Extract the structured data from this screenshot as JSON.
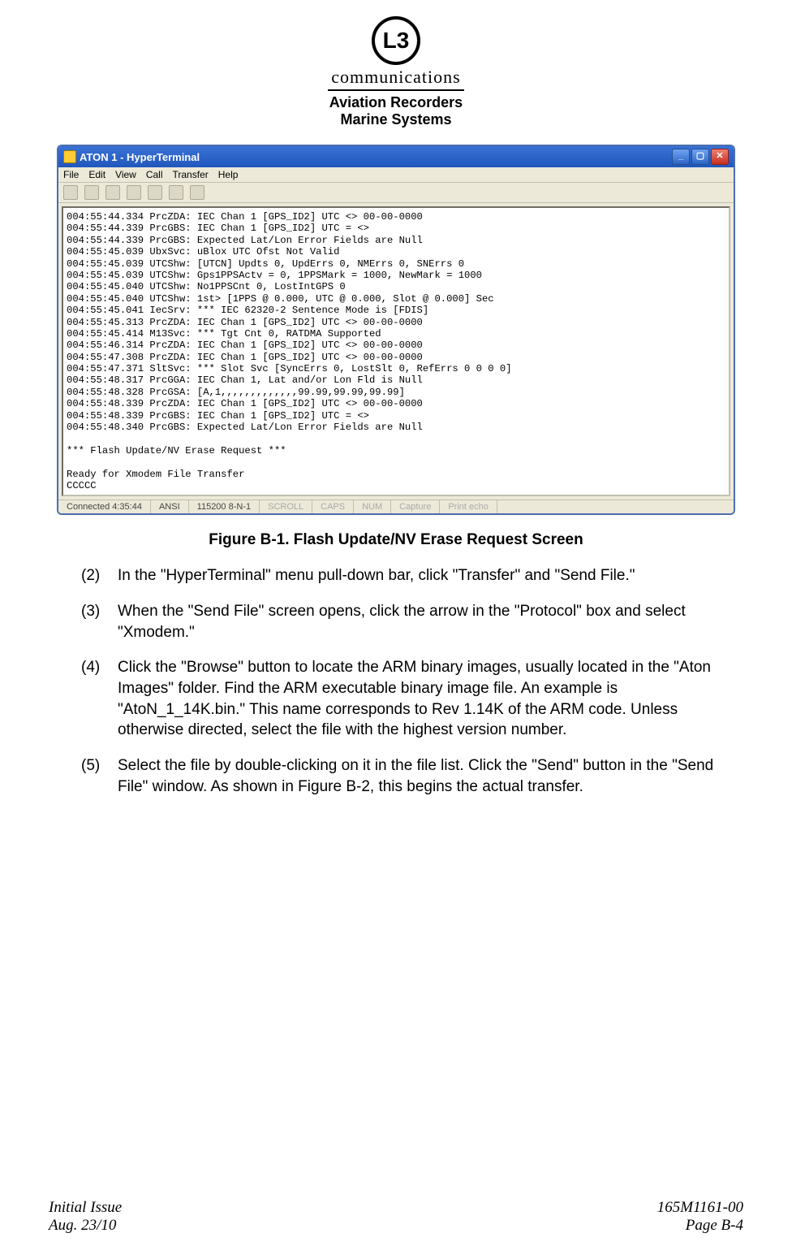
{
  "header": {
    "logo_text": "L3",
    "logo_sub": "communications",
    "line1": "Aviation Recorders",
    "line2": "Marine Systems"
  },
  "window": {
    "title": "ATON 1 - HyperTerminal",
    "menu": [
      "File",
      "Edit",
      "View",
      "Call",
      "Transfer",
      "Help"
    ],
    "terminal_lines": [
      "004:55:44.334 PrcZDA: IEC Chan 1 [GPS_ID2] UTC <> 00-00-0000",
      "004:55:44.339 PrcGBS: IEC Chan 1 [GPS_ID2] UTC = <>",
      "004:55:44.339 PrcGBS: Expected Lat/Lon Error Fields are Null",
      "004:55:45.039 UbxSvc: uBlox UTC Ofst Not Valid",
      "004:55:45.039 UTCShw: [UTCN] Updts 0, UpdErrs 0, NMErrs 0, SNErrs 0",
      "004:55:45.039 UTCShw: Gps1PPSActv = 0, 1PPSMark = 1000, NewMark = 1000",
      "004:55:45.040 UTCShw: No1PPSCnt 0, LostIntGPS 0",
      "004:55:45.040 UTCShw: 1st> [1PPS @ 0.000, UTC @ 0.000, Slot @ 0.000] Sec",
      "004:55:45.041 IecSrv: *** IEC 62320-2 Sentence Mode is [FDIS]",
      "004:55:45.313 PrcZDA: IEC Chan 1 [GPS_ID2] UTC <> 00-00-0000",
      "004:55:45.414 M13Svc: *** Tgt Cnt 0, RATDMA Supported",
      "004:55:46.314 PrcZDA: IEC Chan 1 [GPS_ID2] UTC <> 00-00-0000",
      "004:55:47.308 PrcZDA: IEC Chan 1 [GPS_ID2] UTC <> 00-00-0000",
      "004:55:47.371 SltSvc: *** Slot Svc [SyncErrs 0, LostSlt 0, RefErrs 0 0 0 0]",
      "004:55:48.317 PrcGGA: IEC Chan 1, Lat and/or Lon Fld is Null",
      "004:55:48.328 PrcGSA: [A,1,,,,,,,,,,,,,99.99,99.99,99.99]",
      "004:55:48.339 PrcZDA: IEC Chan 1 [GPS_ID2] UTC <> 00-00-0000",
      "004:55:48.339 PrcGBS: IEC Chan 1 [GPS_ID2] UTC = <>",
      "004:55:48.340 PrcGBS: Expected Lat/Lon Error Fields are Null",
      "",
      "*** Flash Update/NV Erase Request ***",
      "",
      "Ready for Xmodem File Transfer",
      "CCCCC"
    ],
    "status": {
      "connected": "Connected 4:35:44",
      "emulation": "ANSI",
      "port": "115200 8-N-1",
      "scroll": "SCROLL",
      "caps": "CAPS",
      "num": "NUM",
      "capture": "Capture",
      "print": "Print echo"
    }
  },
  "figure_caption": "Figure B-1.  Flash Update/NV Erase Request Screen",
  "steps": [
    {
      "num": "(2)",
      "text": "In the \"HyperTerminal\" menu pull-down bar, click \"Transfer\" and \"Send File.\""
    },
    {
      "num": "(3)",
      "text": "When the \"Send File\" screen opens, click the arrow in the \"Protocol\" box and select \"Xmodem.\""
    },
    {
      "num": "(4)",
      "text": "Click the \"Browse\" button to locate the ARM binary images, usually located in the \"Aton Images\" folder. Find the ARM executable binary image file. An example is \"AtoN_1_14K.bin.\" This name corresponds to Rev 1.14K of the ARM code. Unless otherwise directed, select the file with the highest version number."
    },
    {
      "num": "(5)",
      "text": "Select the file by double-clicking on it in the file list. Click the \"Send\" button in the \"Send File\" window. As shown in Figure B-2, this begins the actual transfer."
    }
  ],
  "footer": {
    "left1": "Initial Issue",
    "left2": "Aug. 23/10",
    "right1": "165M1161-00",
    "right2": "Page B-4"
  }
}
